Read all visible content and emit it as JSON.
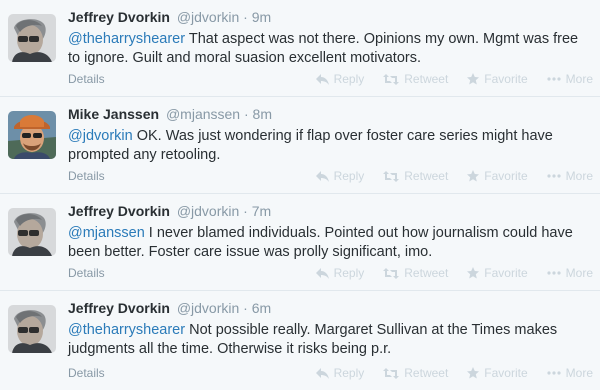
{
  "tweets": [
    {
      "fullname": "Jeffrey Dvorkin",
      "username": "@jdvorkin",
      "sep": "·",
      "time": "9m",
      "mention": "@theharryshearer",
      "text": " That aspect was not there. Opinions my own. Mgmt was free to ignore. Guilt and moral suasion excellent motivators.",
      "details": "Details",
      "avatar": "avatar-jeffrey"
    },
    {
      "fullname": "Mike Janssen",
      "username": "@mjanssen",
      "sep": "·",
      "time": "8m",
      "mention": "@jdvorkin",
      "text": " OK. Was just wondering if flap over foster care series might have prompted any retooling.",
      "details": "Details",
      "avatar": "avatar-mike"
    },
    {
      "fullname": "Jeffrey Dvorkin",
      "username": "@jdvorkin",
      "sep": "·",
      "time": "7m",
      "mention": "@mjanssen",
      "text": " I never blamed individuals. Pointed out how journalism could have been better. Foster care issue was prolly significant, imo.",
      "details": "Details",
      "avatar": "avatar-jeffrey"
    },
    {
      "fullname": "Jeffrey Dvorkin",
      "username": "@jdvorkin",
      "sep": "·",
      "time": "6m",
      "mention": "@theharryshearer",
      "text": " Not possible really. Margaret Sullivan at the Times makes judgments all the time. Otherwise it risks being p.r.",
      "details": "Details",
      "avatar": "avatar-jeffrey"
    }
  ],
  "actions": {
    "reply": "Reply",
    "retweet": "Retweet",
    "favorite": "Favorite",
    "more": "More"
  },
  "colors": {
    "mention": "#2b7bb9",
    "muted": "#8899a6",
    "action": "#ccd6dd",
    "background": "#f5f8fa"
  },
  "icons": [
    "reply-icon",
    "retweet-icon",
    "star-icon",
    "more-dots-icon"
  ]
}
